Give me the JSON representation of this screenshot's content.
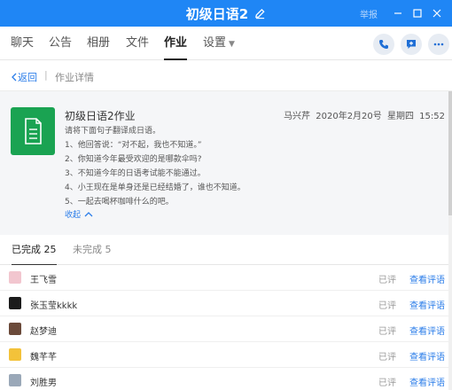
{
  "window": {
    "title": "初级日语2",
    "report_label": "举报",
    "colors": {
      "titlebar": "#1f86f5",
      "accent": "#2b7de9",
      "doc_icon": "#1aa352"
    }
  },
  "tabs": [
    {
      "label": "聊天"
    },
    {
      "label": "公告"
    },
    {
      "label": "相册"
    },
    {
      "label": "文件"
    },
    {
      "label": "作业"
    },
    {
      "label": "设置"
    }
  ],
  "toolbar_icons": [
    "phone-icon",
    "chat-add-icon",
    "more-icon"
  ],
  "breadcrumb": {
    "back": "返回",
    "separator": "|",
    "current": "作业详情"
  },
  "homework": {
    "title": "初级日语2作业",
    "author": "马兴芹",
    "date": "2020年2月20号",
    "weekday": "星期四",
    "time": "15:52",
    "lines": [
      "请将下面句子翻译成日语。",
      "1、他回答说：“对不起，我也不知道。”",
      "2、你知道今年最受欢迎的是哪款伞吗?",
      "3、不知道今年的日语考试能不能通过。",
      "4、小王现在是单身还是已经结婚了，谁也不知道。",
      "5、一起去喝杯咖啡什么的吧。"
    ],
    "collapse_label": "收起"
  },
  "status_tabs": {
    "done_label": "已完成",
    "done_count": "25",
    "undone_label": "未完成",
    "undone_count": "5"
  },
  "students": [
    {
      "name": "王飞雪",
      "status": "已评",
      "action": "查看评语",
      "avatar_color": "#f2c6cf"
    },
    {
      "name": "张玉莹kkkk",
      "status": "已评",
      "action": "查看评语",
      "avatar_color": "#1b1b1b"
    },
    {
      "name": "赵梦迪",
      "status": "已评",
      "action": "查看评语",
      "avatar_color": "#6b4a3a"
    },
    {
      "name": "魏芊芊",
      "status": "已评",
      "action": "查看评语",
      "avatar_color": "#f3c23a"
    },
    {
      "name": "刘胜男",
      "status": "已评",
      "action": "查看评语",
      "avatar_color": "#9aa8b8"
    }
  ]
}
